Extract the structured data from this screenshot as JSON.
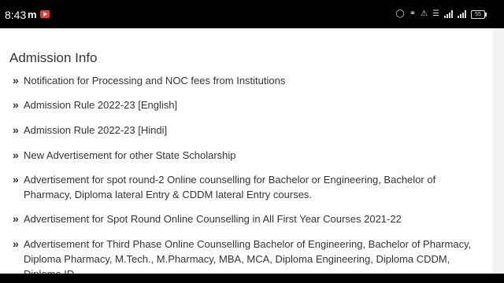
{
  "status_bar": {
    "time": "8:43",
    "app_icon": "m",
    "battery": "55",
    "icons": [
      "youtube-icon",
      "drop-icon",
      "headset-icon",
      "bell-off-icon",
      "volte-icon",
      "signal-icon",
      "signal-icon",
      "battery-icon"
    ]
  },
  "page": {
    "heading": "Admission Info",
    "items": [
      {
        "label": "Notification for Processing and NOC fees from Institutions"
      },
      {
        "label": "Admission Rule 2022-23 [English]"
      },
      {
        "label": "Admission Rule 2022-23 [Hindi]"
      },
      {
        "label": "New Advertisement for other State Scholarship"
      },
      {
        "label": "Advertisement for spot round-2 Online counselling for Bachelor or Engineering, Bachelor of Pharmacy, Diploma lateral Entry & CDDM lateral Entry courses."
      },
      {
        "label": "Advertisement for Spot Round Online Counselling in All First Year Courses 2021-22"
      },
      {
        "label": "Advertisement for Third Phase Online Counselling Bachelor of Engineering, Bachelor of Pharmacy, Diploma Pharmacy, M.Tech., M.Pharmacy, MBA, MCA, Diploma Engineering, Diploma CDDM, Diploma ID,"
      }
    ]
  },
  "colors": {
    "status_bg": "#000000",
    "page_bg": "#ffffff",
    "text": "#333333",
    "yt_red": "#e53935"
  }
}
